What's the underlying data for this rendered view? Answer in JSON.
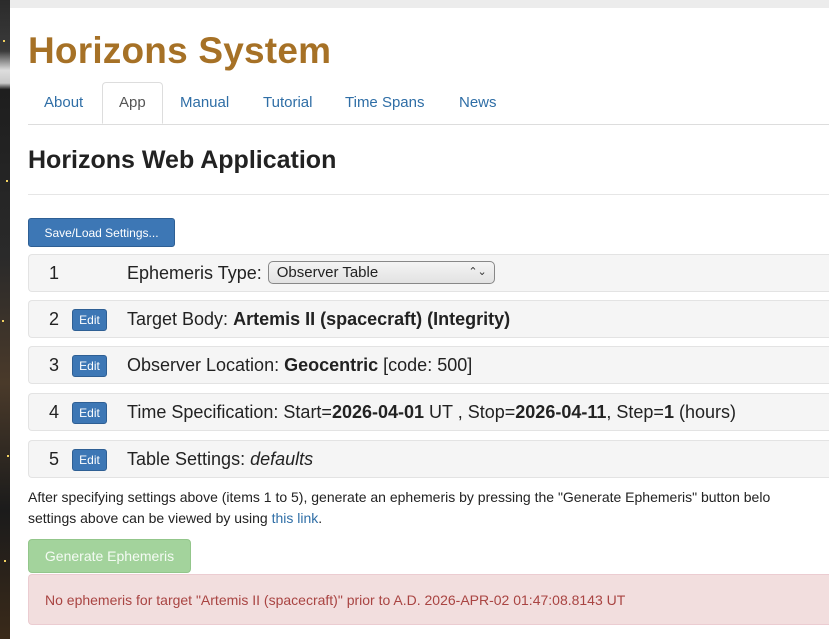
{
  "site": {
    "title": "Horizons System"
  },
  "nav": {
    "tabs": [
      {
        "label": "About"
      },
      {
        "label": "App",
        "active": true
      },
      {
        "label": "Manual"
      },
      {
        "label": "Tutorial"
      },
      {
        "label": "Time Spans"
      },
      {
        "label": "News"
      }
    ]
  },
  "app": {
    "title": "Horizons Web Application",
    "save_load_label": "Save/Load Settings...",
    "edit_label": "Edit"
  },
  "settings": {
    "ephemeris": {
      "num": "1",
      "label": "Ephemeris Type:",
      "selected": "Observer Table"
    },
    "target": {
      "num": "2",
      "label": "Target Body:",
      "value": "Artemis II (spacecraft) (Integrity)"
    },
    "observer": {
      "num": "3",
      "label": "Observer Location:",
      "value": "Geocentric",
      "code": "[code: 500]"
    },
    "time": {
      "num": "4",
      "label": "Time Specification:",
      "start_label": "Start=",
      "start": "2026-04-01",
      "start_suffix": "UT ,",
      "stop_label": "Stop=",
      "stop": "2026-04-11",
      "step_label": "Step=",
      "step": "1",
      "step_unit": "(hours)"
    },
    "table": {
      "num": "5",
      "label": "Table Settings:",
      "value": "defaults"
    }
  },
  "info": {
    "line1": "After specifying settings above (items 1 to 5), generate an ephemeris by pressing the \"Generate Ephemeris\" button belo",
    "line2_prefix": "settings above can be viewed by using",
    "link_text": "this link",
    "line2_suffix": "."
  },
  "generate_label": "Generate Ephemeris",
  "alert": {
    "message": "No ephemeris for target \"Artemis II (spacecraft)\" prior to A.D. 2026-APR-02 01:47:08.8143 UT"
  },
  "colors": {
    "title": "#a67126",
    "link": "#2f6ea6",
    "primary": "#3d77b5",
    "success": "#a3d39c",
    "danger_text": "#a94442",
    "danger_bg": "#f2dede"
  },
  "icons": {
    "select": "chevron-up-down-icon"
  }
}
